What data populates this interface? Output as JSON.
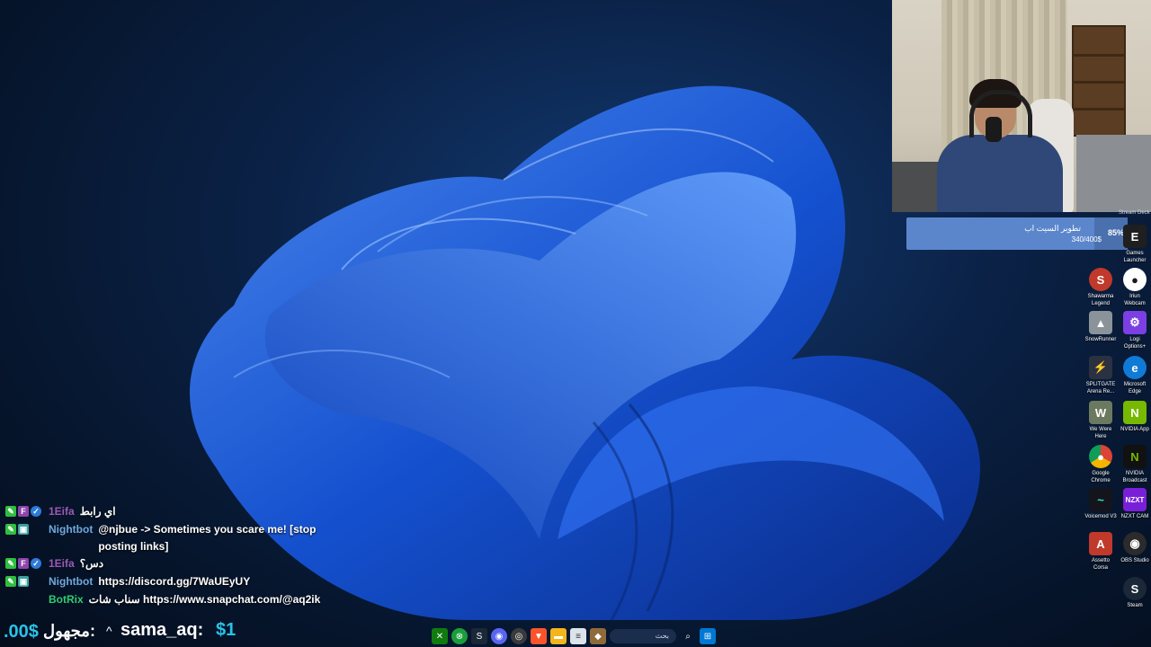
{
  "colors": {
    "desktop_bg": "#0b2247",
    "goal_fill": "#5b86cc",
    "ticker_amount": "#29c3e8",
    "name_purple": "#9b59b6",
    "name_nightbot": "#6fa8dc",
    "name_botrix": "#2ecc71"
  },
  "webcam": {
    "tag": "Stream Deck"
  },
  "goal": {
    "title": "تطوير السيت اب",
    "amount": "340/400$",
    "percent_label": "85%",
    "progress": 0.85
  },
  "desktop_icons": [
    {
      "label": "Games\nLauncher",
      "icon": "epic-games-icon"
    },
    {
      "label": "Shawarma\nLegend",
      "icon": "shawarma-icon"
    },
    {
      "label": "Iriun\nWebcam",
      "icon": "webcam-icon"
    },
    {
      "label": "SnowRunner",
      "icon": "snowrunner-icon"
    },
    {
      "label": "Logi\nOptions+",
      "icon": "logi-icon"
    },
    {
      "label": "SPLITGATE\nArena Re...",
      "icon": "splitgate-icon"
    },
    {
      "label": "Microsoft\nEdge",
      "icon": "edge-icon"
    },
    {
      "label": "We Were\nHere",
      "icon": "we-were-here-icon"
    },
    {
      "label": "NVIDIA App",
      "icon": "nvidia-icon"
    },
    {
      "label": "Google\nChrome",
      "icon": "chrome-icon"
    },
    {
      "label": "NVIDIA\nBroadcast",
      "icon": "nvidia-broadcast-icon"
    },
    {
      "label": "Voicemod V3",
      "icon": "voicemod-icon"
    },
    {
      "label": "NZXT CAM",
      "icon": "nzxt-icon"
    },
    {
      "label": "Assetto\nCorsa",
      "icon": "assetto-icon"
    },
    {
      "label": "OBS Studio",
      "icon": "obs-icon"
    },
    {
      "label": "Steam",
      "icon": "steam-icon"
    }
  ],
  "chat": [
    {
      "user": "1Eifa",
      "text": "اي رابط",
      "badges": [
        "edit",
        "sub",
        "verified"
      ]
    },
    {
      "user": "Nightbot",
      "text": "@njbue -> Sometimes you scare me! [stop posting links]",
      "badges": [
        "edit",
        "bot"
      ]
    },
    {
      "user": "1Eifa",
      "text": "دس؟",
      "badges": [
        "edit",
        "sub",
        "verified"
      ]
    },
    {
      "user": "Nightbot",
      "text": "https://discord.gg/7WaUEyUY",
      "badges": [
        "edit",
        "bot"
      ]
    },
    {
      "user": "BotRix",
      "text": "سناب شات https://www.snapchat.com/@aq2ik",
      "badges": []
    }
  ],
  "ticker": {
    "amount1": ".00$",
    "name1": "مجهول:",
    "name2": "sama_aq:",
    "amount2": "$1"
  },
  "taskbar": {
    "search_text": "بحث",
    "apps": [
      "xbox-icon",
      "xbox-app-icon",
      "steam-icon",
      "discord-icon",
      "obs-icon",
      "brave-icon",
      "folder-icon",
      "notepad-icon",
      "game-icon"
    ]
  }
}
